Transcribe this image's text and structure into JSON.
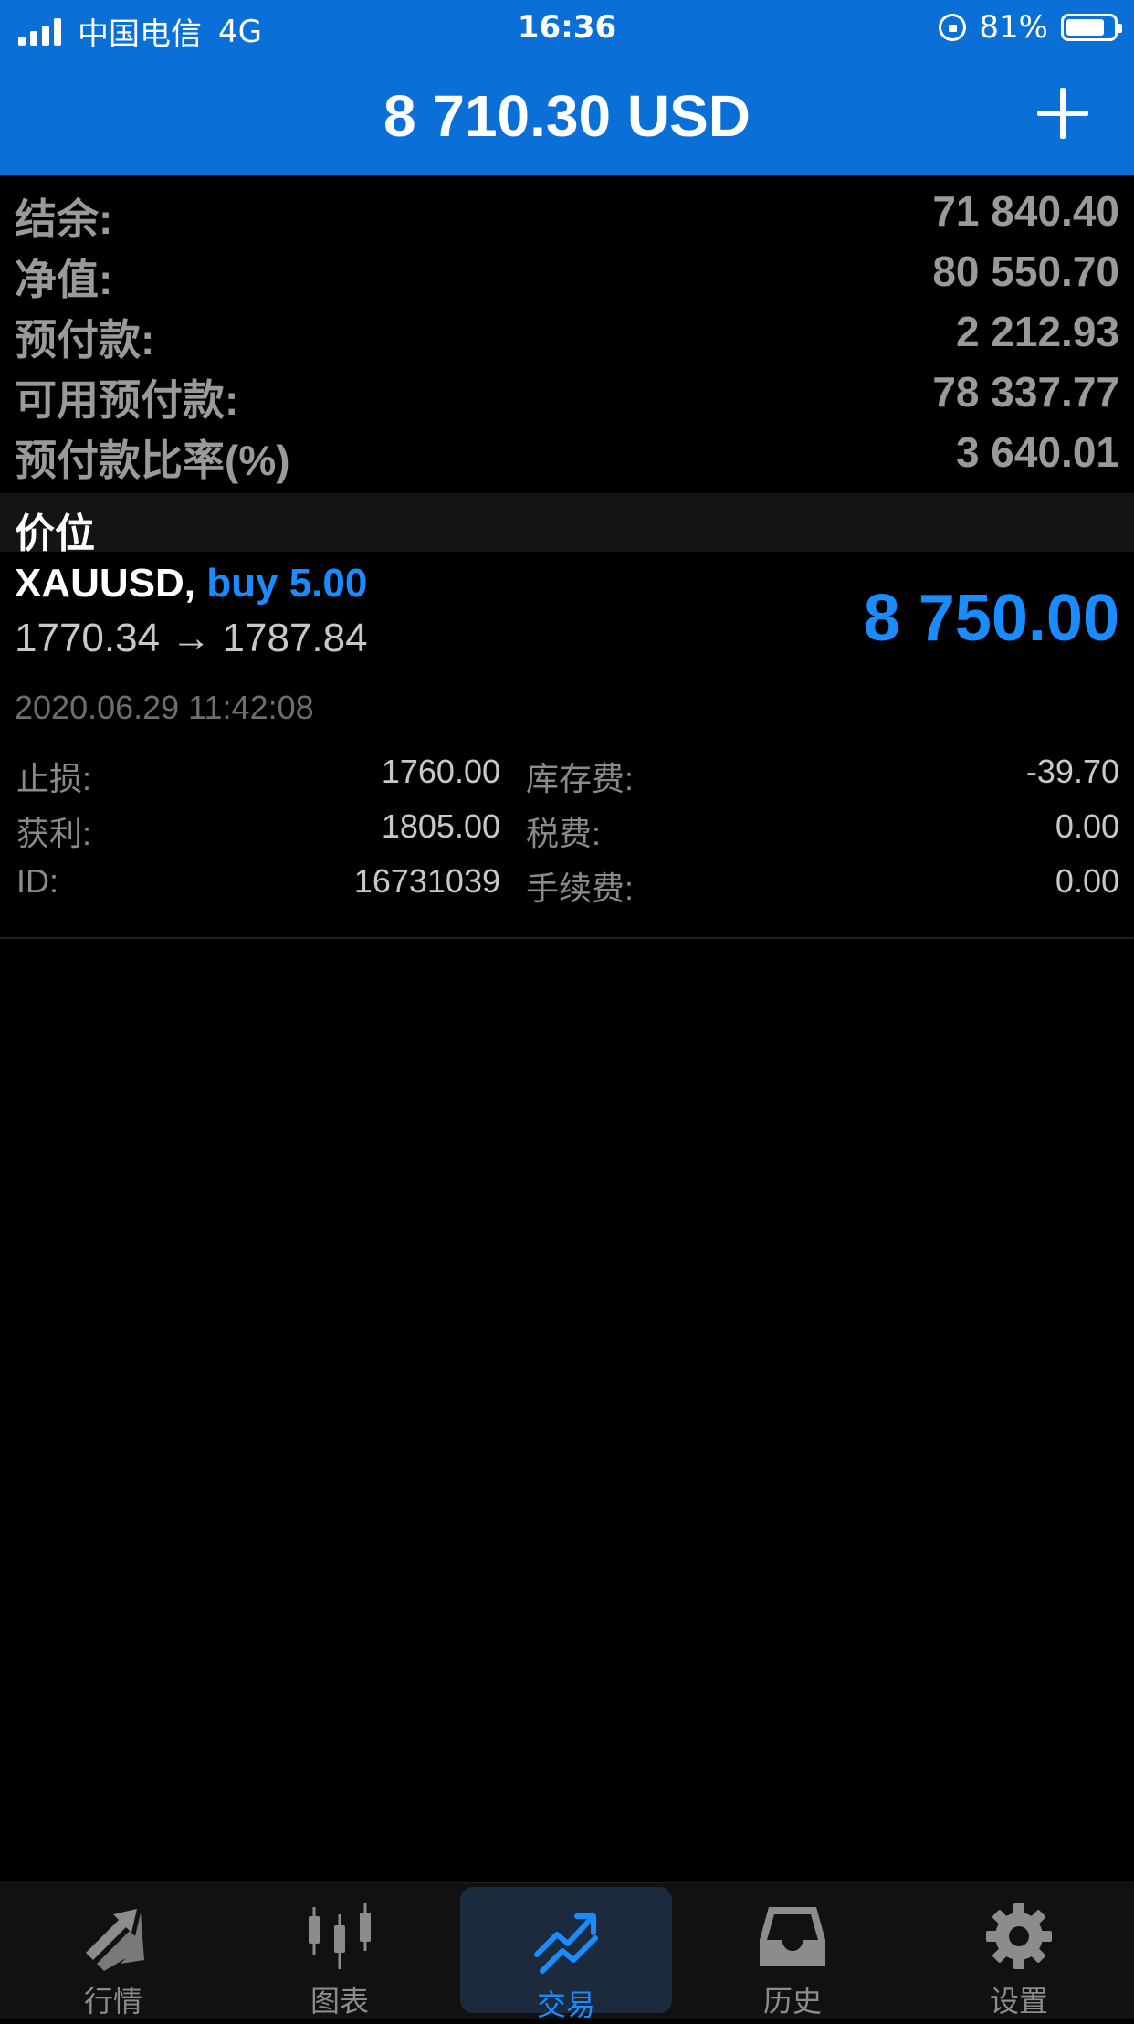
{
  "status_bar": {
    "carrier": "中国电信",
    "network": "4G",
    "time": "16:36",
    "battery_percent": "81%",
    "battery_level": 0.81
  },
  "header": {
    "title": "8 710.30 USD",
    "add_icon": "plus-icon"
  },
  "summary": {
    "rows": [
      {
        "label": "结余:",
        "value": "71 840.40"
      },
      {
        "label": "净值:",
        "value": "80 550.70"
      },
      {
        "label": "预付款:",
        "value": "2 212.93"
      },
      {
        "label": "可用预付款:",
        "value": "78 337.77"
      },
      {
        "label": "预付款比率(%)",
        "value": "3 640.01"
      }
    ]
  },
  "section": {
    "title": "价位"
  },
  "position": {
    "symbol": "XAUUSD,",
    "side": "buy 5.00",
    "prices": "1770.34 → 1787.84",
    "profit": "8 750.00",
    "time": "2020.06.29 11:42:08",
    "details": {
      "sl_label": "止损:",
      "sl_value": "1760.00",
      "swap_label": "库存费:",
      "swap_value": "-39.70",
      "tp_label": "获利:",
      "tp_value": "1805.00",
      "tax_label": "税费:",
      "tax_value": "0.00",
      "id_label": "ID:",
      "id_value": "16731039",
      "commission_label": "手续费:",
      "commission_value": "0.00"
    }
  },
  "tabs": [
    {
      "label": "行情",
      "icon": "quotes-arrows-icon",
      "active": false
    },
    {
      "label": "图表",
      "icon": "candlestick-icon",
      "active": false
    },
    {
      "label": "交易",
      "icon": "trade-trend-icon",
      "active": true
    },
    {
      "label": "历史",
      "icon": "inbox-tray-icon",
      "active": false
    },
    {
      "label": "设置",
      "icon": "gear-icon",
      "active": false
    }
  ],
  "colors": {
    "header_blue": "#0a6fd6",
    "accent_blue": "#1a8cff",
    "background": "#000000"
  }
}
